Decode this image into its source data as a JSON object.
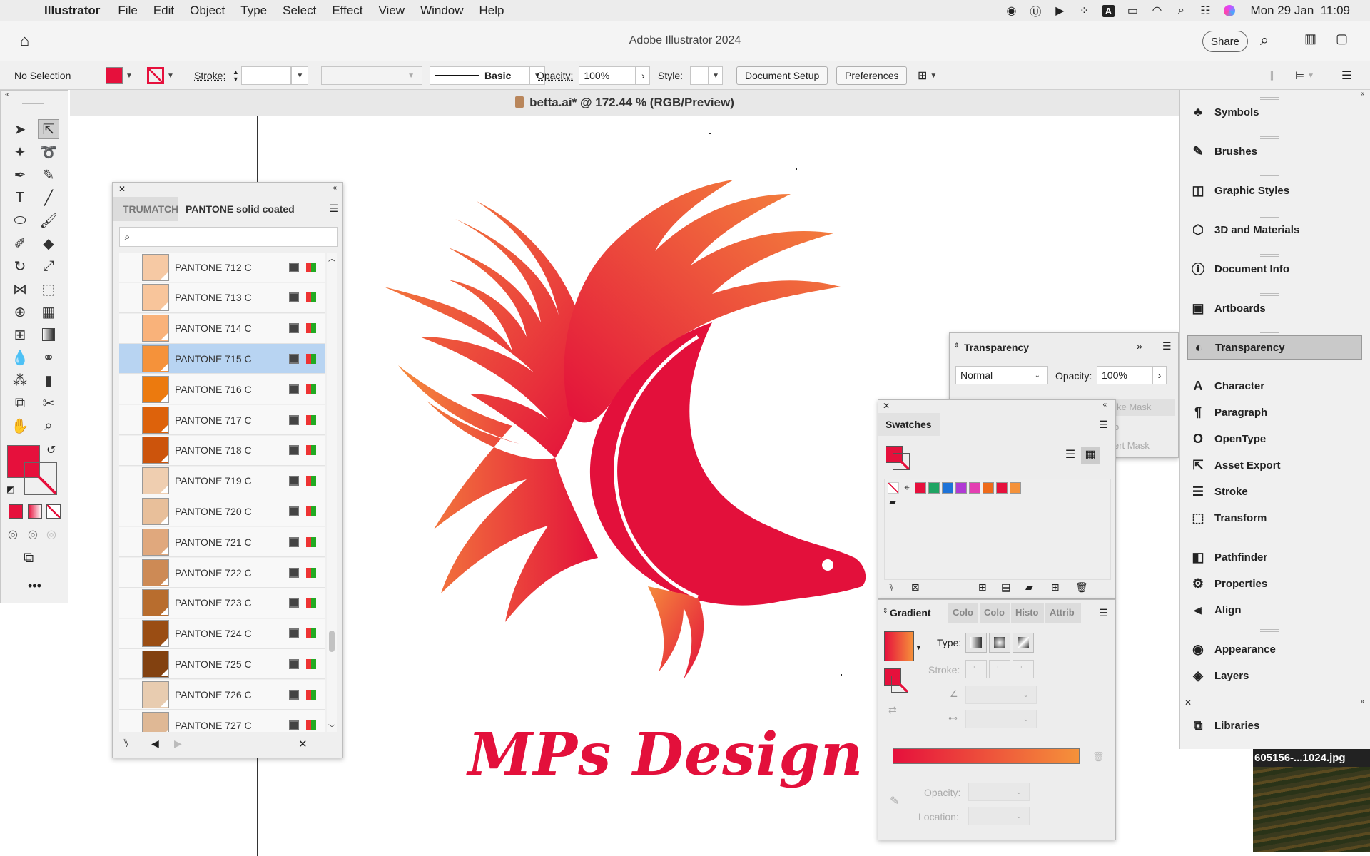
{
  "menubar": {
    "app": "Illustrator",
    "items": [
      "File",
      "Edit",
      "Object",
      "Type",
      "Select",
      "Effect",
      "View",
      "Window",
      "Help"
    ],
    "clock": "Mon 29 Jan  11:09"
  },
  "title": {
    "app_title": "Adobe Illustrator 2024",
    "share": "Share"
  },
  "control": {
    "selection": "No Selection",
    "stroke_label": "Stroke:",
    "brush": "Basic",
    "opacity_label": "Opacity:",
    "opacity": "100%",
    "style_label": "Style:",
    "doc_setup": "Document Setup",
    "prefs": "Preferences",
    "fill_color": "#e6103c"
  },
  "document": {
    "tab": "betta.ai* @ 172.44 % (RGB/Preview)"
  },
  "artwork": {
    "logo_text": "MPs Design",
    "primary": "#e3103b",
    "secondary": "#f58a3c"
  },
  "pantone_panel": {
    "tabs": [
      "TRUMATCH",
      "PANTONE solid coated"
    ],
    "search_placeholder": "",
    "swatches": [
      {
        "name": "PANTONE 712 C",
        "color": "#f6c9a4"
      },
      {
        "name": "PANTONE 713 C",
        "color": "#f8c59b"
      },
      {
        "name": "PANTONE 714 C",
        "color": "#f9b27a"
      },
      {
        "name": "PANTONE 715 C",
        "color": "#f5923a"
      },
      {
        "name": "PANTONE 716 C",
        "color": "#ec7a0e"
      },
      {
        "name": "PANTONE 717 C",
        "color": "#dd620b"
      },
      {
        "name": "PANTONE 718 C",
        "color": "#cc540c"
      },
      {
        "name": "PANTONE 719 C",
        "color": "#efceb0"
      },
      {
        "name": "PANTONE 720 C",
        "color": "#e8bf9a"
      },
      {
        "name": "PANTONE 721 C",
        "color": "#e0a87d"
      },
      {
        "name": "PANTONE 722 C",
        "color": "#cd8a55"
      },
      {
        "name": "PANTONE 723 C",
        "color": "#b86d2e"
      },
      {
        "name": "PANTONE 724 C",
        "color": "#9a4d13"
      },
      {
        "name": "PANTONE 725 C",
        "color": "#824110"
      },
      {
        "name": "PANTONE 726 C",
        "color": "#e8ccb0"
      },
      {
        "name": "PANTONE 727 C",
        "color": "#dfb895"
      }
    ],
    "selected_index": 3
  },
  "transparency": {
    "title": "Transparency",
    "mode": "Normal",
    "opacity_label": "Opacity:",
    "opacity": "100%",
    "mask_btn": "ke Mask",
    "invert": "ert Mask",
    "clip": "p"
  },
  "swatches": {
    "title": "Swatches",
    "chips": [
      "#e6103c",
      "#1fa463",
      "#1d73d8",
      "#b03ad4",
      "#e43fb2",
      "#ee6a1a",
      "#e6103c",
      "#f5923a"
    ]
  },
  "gradient": {
    "tabs": [
      "Gradient",
      "Colo",
      "Colo",
      "Histo",
      "Attrib"
    ],
    "type_label": "Type:",
    "stroke_label": "Stroke:",
    "opacity_label": "Opacity:",
    "location_label": "Location:",
    "start": "#e6103c",
    "end": "#f5923a"
  },
  "dock": {
    "items": [
      "Symbols",
      "Brushes",
      "Graphic Styles",
      "3D and Materials",
      "Document Info",
      "Artboards",
      "Transparency",
      "Character",
      "Paragraph",
      "OpenType",
      "Asset Export",
      "Stroke",
      "Transform",
      "Pathfinder",
      "Properties",
      "Align",
      "Appearance",
      "Layers",
      "Libraries"
    ],
    "icons": [
      "club-icon",
      "brush-icon",
      "graphic-styles-icon",
      "cube-icon",
      "info-icon",
      "artboard-icon",
      "transparency-icon",
      "character-icon",
      "paragraph-icon",
      "opentype-icon",
      "export-icon",
      "stroke-icon",
      "transform-icon",
      "pathfinder-icon",
      "properties-icon",
      "align-icon",
      "appearance-icon",
      "layers-icon",
      "libraries-icon"
    ],
    "active": "Transparency"
  },
  "desktop_file": {
    "name": "605156-...1024.jpg"
  }
}
